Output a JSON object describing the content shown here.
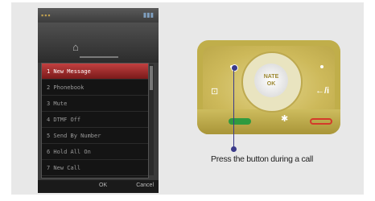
{
  "phone": {
    "signal_label": "▪▪▪",
    "battery_label": "▮▮▮",
    "menu": [
      "1 New Message",
      "2 Phonebook",
      "3 Mute",
      "4 DTMF Off",
      "5 Send By Number",
      "6 Hold All On",
      "7 New Call"
    ],
    "selected_index": 0,
    "softkeys": {
      "middle": "OK",
      "right": "Cancel"
    },
    "home_icon": "home-icon"
  },
  "keypad": {
    "ok_brand": "NATE",
    "ok_label": "OK",
    "camera_icon": "camera-icon",
    "clear_label": "←/i",
    "bluetooth_icon": "bluetooth-icon"
  },
  "caption": "Press the button during a call",
  "colors": {
    "selected_row": "#b03030",
    "keypad_gold": "#c0ae4a",
    "call_key": "#2f9a3f",
    "end_key": "#d43a2a",
    "callout": "#3a3a8a"
  }
}
